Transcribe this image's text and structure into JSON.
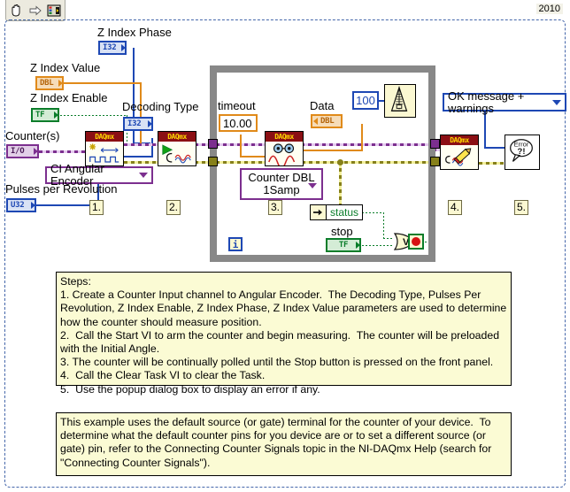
{
  "window": {
    "version_label": "2010"
  },
  "toolbar": {
    "items": [
      {
        "name": "hand-tool-icon",
        "label": "Hand Tool"
      },
      {
        "name": "run-arrow-icon",
        "label": "Run"
      },
      {
        "name": "connector-pane-icon",
        "label": "Connector Pane"
      }
    ]
  },
  "controls": {
    "z_index_phase": {
      "label": "Z Index Phase",
      "type": "I32"
    },
    "z_index_value": {
      "label": "Z Index Value",
      "type": "DBL"
    },
    "z_index_enable": {
      "label": "Z Index Enable",
      "type": "TF"
    },
    "decoding_type": {
      "label": "Decoding Type",
      "type": "I32"
    },
    "counters": {
      "label": "Counter(s)",
      "type": "I/O"
    },
    "pulses_per_revolution": {
      "label": "Pulses per Revolution",
      "type": "U32"
    },
    "data": {
      "label": "Data",
      "type": "DBL"
    },
    "stop": {
      "label": "stop",
      "type": "TF"
    }
  },
  "constants": {
    "timeout": {
      "label": "timeout",
      "value": "10.00"
    },
    "wait_ms": {
      "value": "100"
    }
  },
  "selectors": {
    "create_channel": {
      "value": "CI Angular Encoder",
      "icon": "chevron-down-icon"
    },
    "read_mode": {
      "line1": "Counter DBL",
      "line2": "1Samp",
      "icon": "chevron-down-icon"
    },
    "error_handler_type": {
      "value": "OK message + warnings",
      "icon": "chevron-down-icon"
    }
  },
  "nodes": {
    "create_channel": {
      "header": "DAQmx",
      "name": "daqmx-create-virtual-channel"
    },
    "start_task": {
      "header": "DAQmx",
      "name": "daqmx-start-task"
    },
    "read": {
      "header": "DAQmx",
      "name": "daqmx-read"
    },
    "clear_task": {
      "header": "DAQmx",
      "name": "daqmx-clear-task"
    },
    "error_handler": {
      "label1": "Error",
      "label2": "?!",
      "name": "simple-error-handler"
    },
    "wait": {
      "name": "wait-until-next-ms-multiple"
    }
  },
  "loop": {
    "iteration_label": "i",
    "unbundle_field": "status"
  },
  "step_numbers": [
    "1.",
    "2.",
    "3.",
    "4.",
    "5."
  ],
  "notes": {
    "steps_box": "Steps:\n1. Create a Counter Input channel to Angular Encoder.  The Decoding Type, Pulses Per Revolution, Z Index Enable, Z Index Phase, Z Index Value parameters are used to determine how the counter should measure position.\n2.  Call the Start VI to arm the counter and begin measuring.  The counter will be preloaded with the Initial Angle.\n3. The counter will be continually polled until the Stop button is pressed on the front panel.\n4.  Call the Clear Task VI to clear the Task.\n5.  Use the popup dialog box to display an error if any.",
    "source_box": "This example uses the default source (or gate) terminal for the counter of your device.  To determine what the default counter pins for you device are or to set a different source (or gate) pin, refer to the Connecting Counter Signals topic in the NI-DAQmx Help (search for \"Connecting Counter Signals\")."
  },
  "colors": {
    "daqmx_header": "#8b0f14",
    "daqmx_header_text": "#ffd700",
    "wire_blue": "#1e48b4",
    "wire_orange": "#e08a1a",
    "wire_purple": "#7c2f8f",
    "wire_green": "#0a7d2a",
    "wire_error": "#86801a",
    "loop_border": "#888888",
    "note_background": "#fbfbd4"
  }
}
